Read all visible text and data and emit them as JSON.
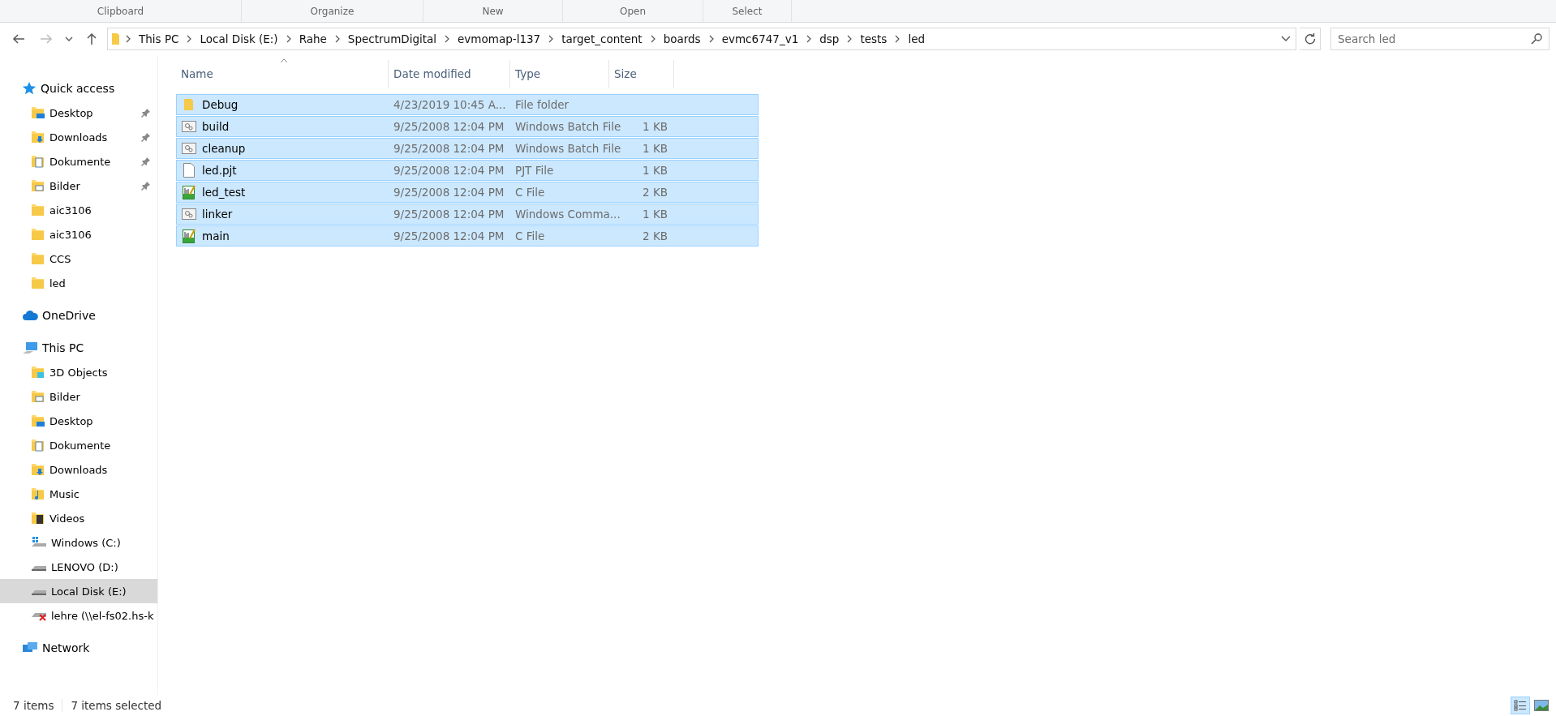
{
  "ribbon_groups": [
    "Clipboard",
    "Organize",
    "New",
    "Open",
    "Select"
  ],
  "address": {
    "crumbs": [
      "This PC",
      "Local Disk (E:)",
      "Rahe",
      "SpectrumDigital",
      "evmomap-l137",
      "target_content",
      "boards",
      "evmc6747_v1",
      "dsp",
      "tests",
      "led"
    ]
  },
  "search": {
    "placeholder": "Search led"
  },
  "sidebar": [
    {
      "label": "Quick access",
      "kind": "star",
      "selected": false,
      "children": [
        {
          "label": "Desktop",
          "kind": "desktop",
          "pinned": true,
          "selected": false
        },
        {
          "label": "Downloads",
          "kind": "downloads",
          "pinned": true,
          "selected": false
        },
        {
          "label": "Dokumente",
          "kind": "documents",
          "pinned": true,
          "selected": false
        },
        {
          "label": "Bilder",
          "kind": "pictures",
          "pinned": true,
          "selected": false
        },
        {
          "label": "aic3106",
          "kind": "folder",
          "pinned": false,
          "selected": false
        },
        {
          "label": "aic3106",
          "kind": "folder",
          "pinned": false,
          "selected": false
        },
        {
          "label": "CCS",
          "kind": "folder",
          "pinned": false,
          "selected": false
        },
        {
          "label": "led",
          "kind": "folder",
          "pinned": false,
          "selected": false
        }
      ]
    },
    {
      "label": "OneDrive",
      "kind": "cloud",
      "selected": false
    },
    {
      "label": "This PC",
      "kind": "pc",
      "selected": false,
      "children": [
        {
          "label": "3D Objects",
          "kind": "objects",
          "pinned": false,
          "selected": false
        },
        {
          "label": "Bilder",
          "kind": "pictures",
          "pinned": false,
          "selected": false
        },
        {
          "label": "Desktop",
          "kind": "desktop",
          "pinned": false,
          "selected": false
        },
        {
          "label": "Dokumente",
          "kind": "documents",
          "pinned": false,
          "selected": false
        },
        {
          "label": "Downloads",
          "kind": "downloads",
          "pinned": false,
          "selected": false
        },
        {
          "label": "Music",
          "kind": "music",
          "pinned": false,
          "selected": false
        },
        {
          "label": "Videos",
          "kind": "videos",
          "pinned": false,
          "selected": false
        },
        {
          "label": "Windows (C:)",
          "kind": "windrive",
          "pinned": false,
          "selected": false
        },
        {
          "label": "LENOVO (D:)",
          "kind": "drive",
          "pinned": false,
          "selected": false
        },
        {
          "label": "Local Disk (E:)",
          "kind": "drive",
          "pinned": false,
          "selected": true
        },
        {
          "label": "lehre (\\\\el-fs02.hs-k",
          "kind": "netdrive",
          "pinned": false,
          "selected": false
        }
      ]
    },
    {
      "label": "Network",
      "kind": "network",
      "selected": false
    }
  ],
  "table": {
    "columns": [
      "Name",
      "Date modified",
      "Type",
      "Size"
    ],
    "rows": [
      {
        "name": "Debug",
        "date": "4/23/2019 10:45 A...",
        "type": "File folder",
        "size": "",
        "kind": "folder",
        "selected": true
      },
      {
        "name": "build",
        "date": "9/25/2008 12:04 PM",
        "type": "Windows Batch File",
        "size": "1 KB",
        "kind": "batch",
        "selected": true
      },
      {
        "name": "cleanup",
        "date": "9/25/2008 12:04 PM",
        "type": "Windows Batch File",
        "size": "1 KB",
        "kind": "batch",
        "selected": true
      },
      {
        "name": "led.pjt",
        "date": "9/25/2008 12:04 PM",
        "type": "PJT File",
        "size": "1 KB",
        "kind": "blank",
        "selected": true
      },
      {
        "name": "led_test",
        "date": "9/25/2008 12:04 PM",
        "type": "C File",
        "size": "2 KB",
        "kind": "cfile",
        "selected": true
      },
      {
        "name": "linker",
        "date": "9/25/2008 12:04 PM",
        "type": "Windows Comma...",
        "size": "1 KB",
        "kind": "batch",
        "selected": true
      },
      {
        "name": "main",
        "date": "9/25/2008 12:04 PM",
        "type": "C File",
        "size": "2 KB",
        "kind": "cfile",
        "selected": true
      }
    ]
  },
  "status_bar": {
    "count": "7 items",
    "selection": "7 items selected"
  },
  "views": [
    {
      "kind": "details",
      "selected": true
    },
    {
      "kind": "thumbnails",
      "selected": false
    }
  ]
}
